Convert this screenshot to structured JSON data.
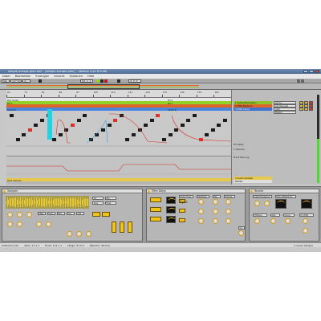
{
  "window": {
    "title": "simple escape plan.als* - [simple escape plan] - Ableton Live 8 Suite",
    "controls": [
      "minimize",
      "maximize",
      "close"
    ]
  },
  "menu": [
    "Datei",
    "Bearbeiten",
    "Erzeugen",
    "Ansicht",
    "Optionen",
    "Hilfe"
  ],
  "transport": {
    "tempo": "127.00",
    "signature": "4 / 4",
    "position": "64. 1. 1",
    "loop_length": "4. 0. 0"
  },
  "arrangement": {
    "ruler": [
      "65",
      "73",
      "81",
      "89",
      "97",
      "105",
      "113",
      "121",
      "129",
      "137",
      "145",
      "153",
      "161"
    ],
    "clips": {
      "top_left": "Poly Synth",
      "green_left": "Fill 7",
      "blue_left": "Chord 8",
      "top_right": "Fill 2",
      "green_right": "Fill 7",
      "blue_right": "Chord 8"
    },
    "bottom_clip": "Bass Sample"
  },
  "mixer": {
    "tracks": [
      {
        "name": "1 Audio Percussion",
        "color": "#8fc22a"
      },
      {
        "name": "2 MIDI Bassline",
        "color": "#e06428"
      },
      {
        "name": "3 MIDI Chord",
        "color": "#3d73d1"
      }
    ],
    "io": [
      "All Ins",
      "All Channels",
      "Auto",
      "Master"
    ],
    "info": [
      "Fill Delay",
      "1 Devices",
      "Track Panning"
    ],
    "bottom_track": "4 Audio Sample",
    "master": "Master"
  },
  "devices": [
    {
      "name": "Sampler"
    },
    {
      "name": "Filter Delay"
    },
    {
      "name": "Reverb"
    }
  ],
  "device_params": {
    "sampler": [
      "Vol",
      "Pan",
      "Tune",
      "Fade",
      "Filter",
      "Freq",
      "Res",
      "Env",
      "LFO"
    ],
    "filter_delay": [
      "Delay Time",
      "Feedback",
      "Pan",
      "Volume",
      "Sync",
      "Dry"
    ],
    "reverb": [
      "Input Processing",
      "Early Reflections",
      "Diffusion",
      "Size",
      "Decay",
      "Dry/Wet"
    ]
  },
  "status": {
    "left": "Sidechain Info",
    "items": [
      "Start: 17.1.1",
      "Ende: 113.1.1",
      "Länge: 97.0.0",
      "(Bereich: 96.0.0)"
    ],
    "right": "4 Audio Sample"
  }
}
